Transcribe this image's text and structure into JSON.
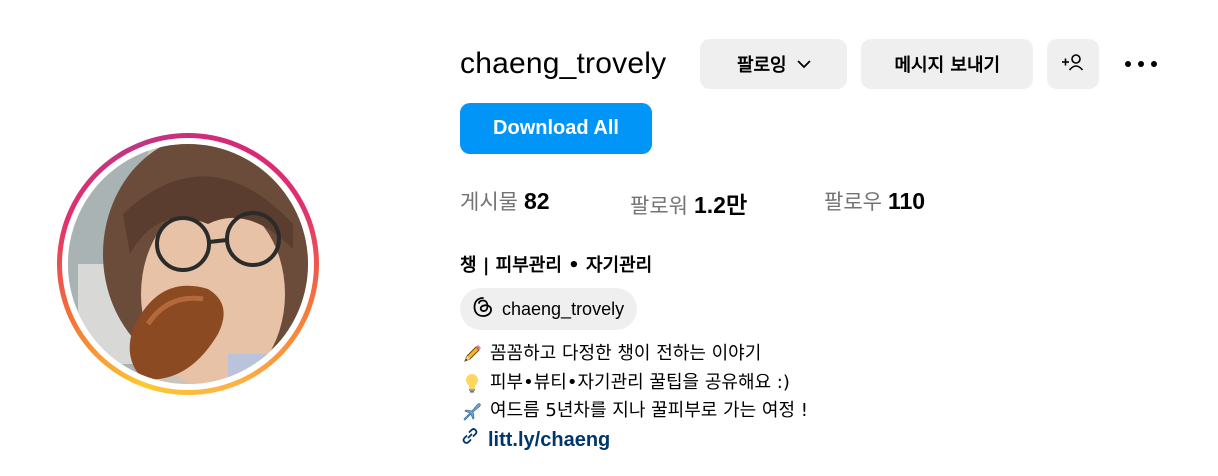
{
  "profile": {
    "username": "chaeng_trovely",
    "full_name": "챙 | 피부관리 • 자기관리",
    "threads_handle": "chaeng_trovely",
    "bio_lines": [
      {
        "icon": "pencil-icon",
        "text": "꼼꼼하고 다정한 챙이 전하는 이야기"
      },
      {
        "icon": "lightbulb-icon",
        "text": "피부•뷰티•자기관리 꿀팁을 공유해요 :)"
      },
      {
        "icon": "airplane-icon",
        "text": "여드름 5년차를 지나 꿀피부로 가는 여정 !"
      }
    ],
    "link": "litt.ly/chaeng"
  },
  "actions": {
    "follow_label": "팔로잉",
    "message_label": "메시지 보내기",
    "download_label": "Download All"
  },
  "stats": {
    "posts_label": "게시물",
    "posts_value": "82",
    "followers_label": "팔로워",
    "followers_value": "1.2만",
    "following_label": "팔로우",
    "following_value": "110"
  },
  "colors": {
    "accent": "#0095f6",
    "link": "#00376b",
    "button_bg": "#efefef",
    "muted_text": "#737373"
  }
}
